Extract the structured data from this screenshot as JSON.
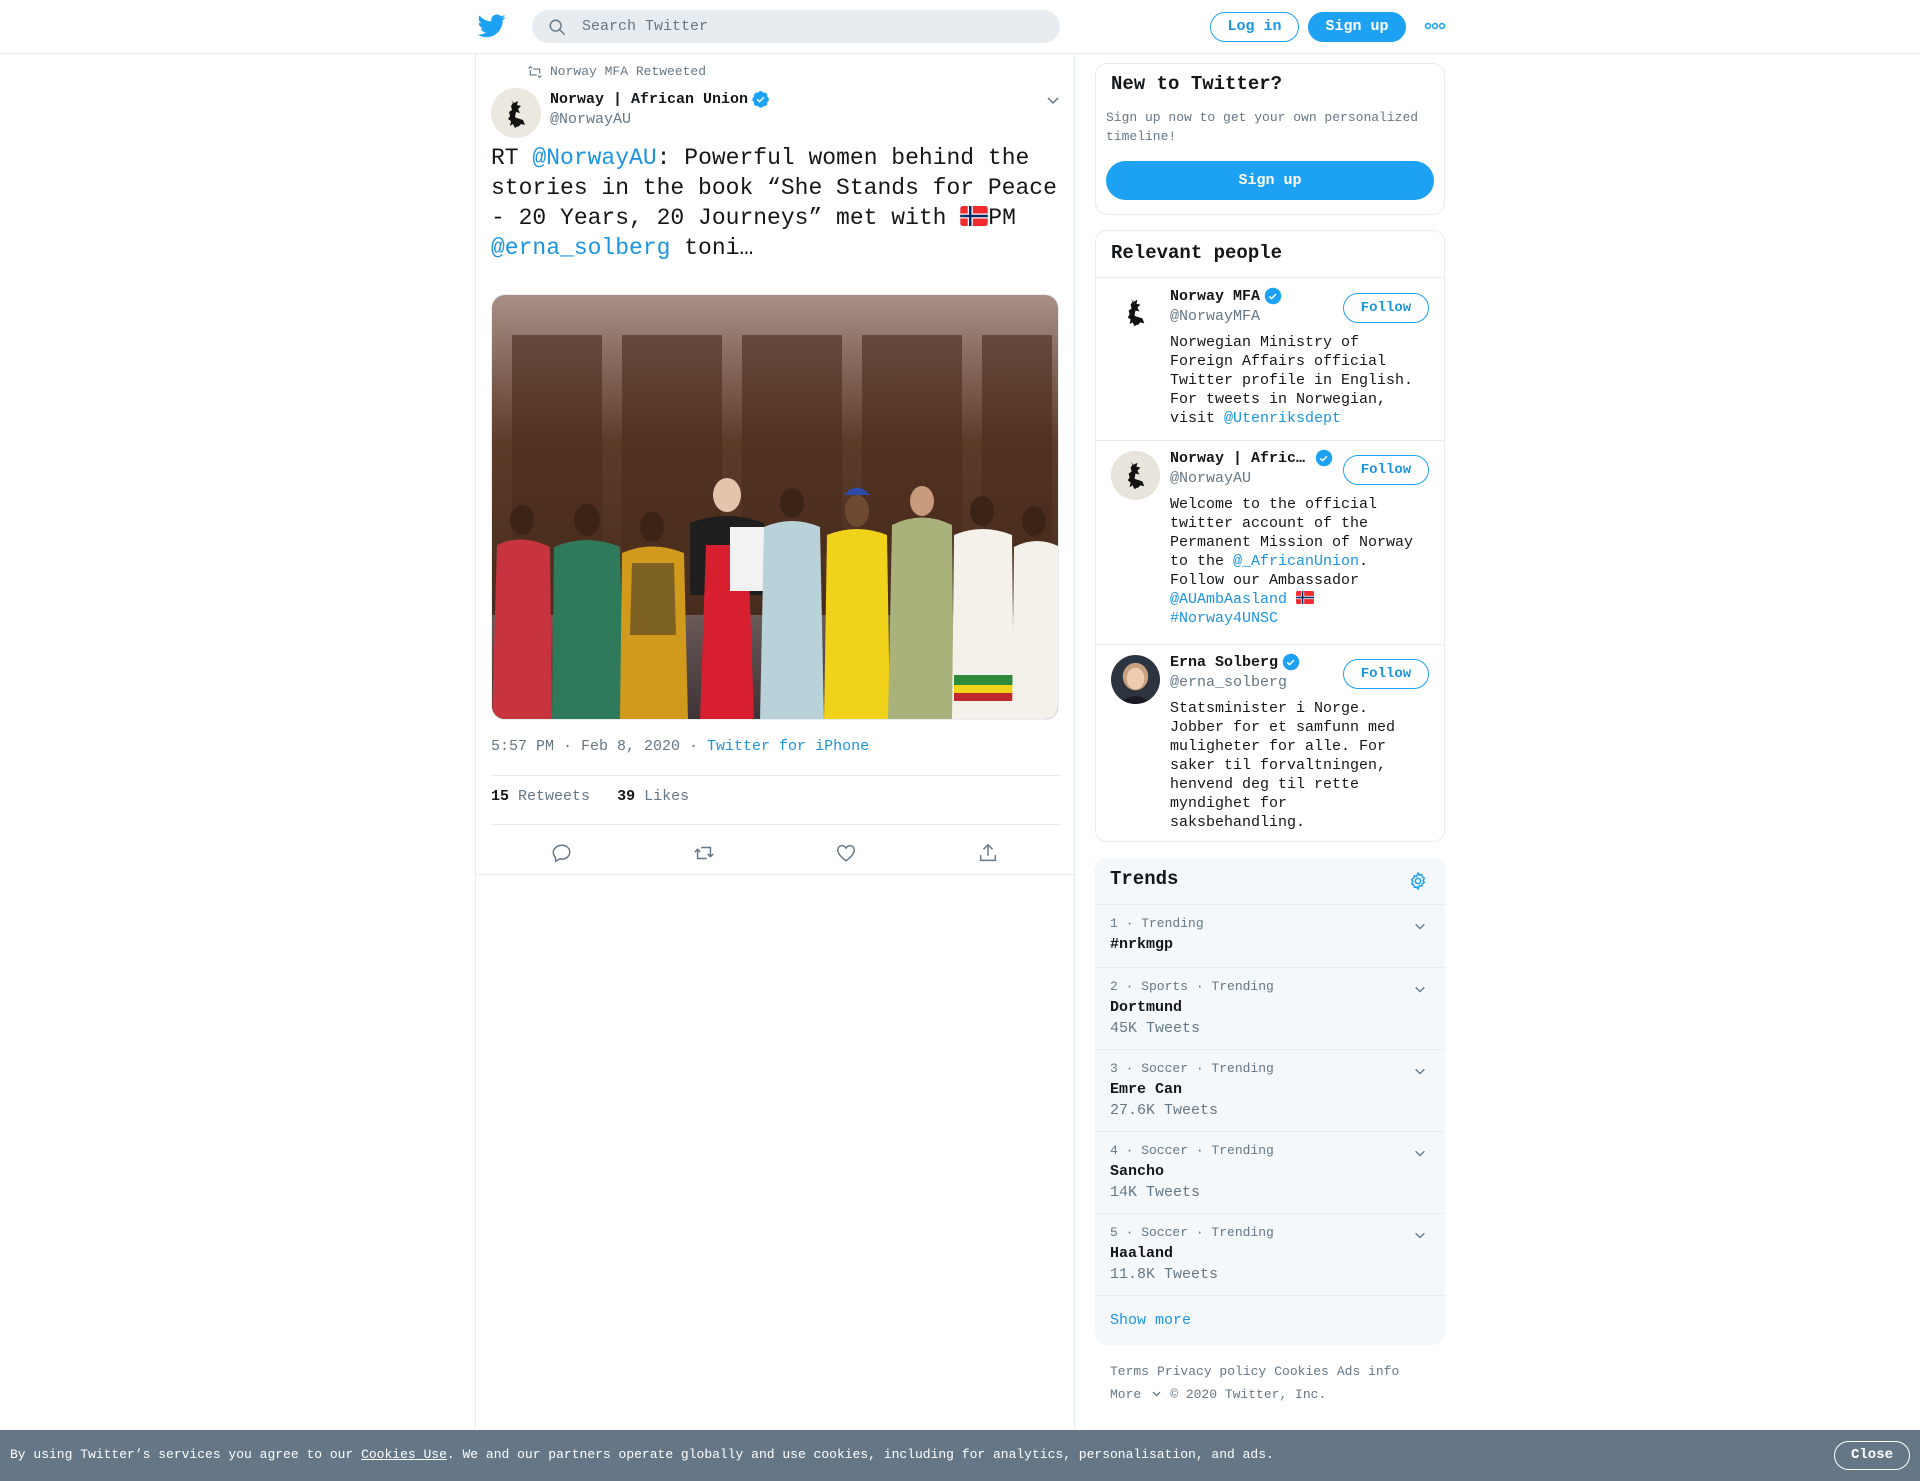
{
  "header": {
    "search_placeholder": "Search Twitter",
    "login_label": "Log in",
    "signup_label": "Sign up",
    "more_icon": "more-dots-icon",
    "brand_color": "#1da1f2"
  },
  "tweet": {
    "retweet_context": "Norway MFA Retweeted",
    "author_name": "Norway | African Union",
    "author_handle": "@NorwayAU",
    "text": {
      "prefix": "RT ",
      "mention1": "@NorwayAU",
      "body": ": Powerful women behind the stories in the book “She Stands for Peace - 20 Years, 20 Journeys” met with ",
      "after_flag": "PM ",
      "mention2": "@erna_solberg",
      "suffix": " toni…"
    },
    "time": "5:57 PM · Feb 8, 2020",
    "separator": " · ",
    "source": "Twitter for iPhone",
    "retweets_count": "15",
    "retweets_label": "Retweets",
    "likes_count": "39",
    "likes_label": "Likes"
  },
  "sidebar": {
    "new_to_twitter": {
      "title": "New to Twitter?",
      "subtitle": "Sign up now to get your own personalized timeline!",
      "button": "Sign up"
    },
    "relevant_people": {
      "title": "Relevant people",
      "follow_label": "Follow",
      "people": [
        {
          "name": "Norway MFA",
          "handle": "@NorwayMFA",
          "bio": "Norwegian Ministry of Foreign Affairs official Twitter profile in English. For tweets in Norwegian, visit ",
          "bio_link": "@Utenriksdept"
        },
        {
          "name": "Norway | Afric…",
          "handle": "@NorwayAU",
          "bio_a": "Welcome to the official twitter account of the Permanent Mission of Norway to the ",
          "bio_link1": "@_AfricanUnion",
          "bio_b": ". Follow our Ambassador ",
          "bio_link2": "@AUAmbAasland",
          "bio_link3": "#Norway4UNSC"
        },
        {
          "name": "Erna Solberg",
          "handle": "@erna_solberg",
          "bio": "Statsminister i Norge. Jobber for et samfunn med muligheter for alle. For saker til forvaltningen, henvend deg til rette myndighet for saksbehandling."
        }
      ]
    },
    "trends": {
      "title": "Trends",
      "items": [
        {
          "meta": "1 · Trending",
          "name": "#nrkmgp",
          "count": ""
        },
        {
          "meta": "2 · Sports · Trending",
          "name": "Dortmund",
          "count": "45K Tweets"
        },
        {
          "meta": "3 · Soccer · Trending",
          "name": "Emre Can",
          "count": "27.6K Tweets"
        },
        {
          "meta": "4 · Soccer · Trending",
          "name": "Sancho",
          "count": "14K Tweets"
        },
        {
          "meta": "5 · Soccer · Trending",
          "name": "Haaland",
          "count": "11.8K Tweets"
        }
      ],
      "show_more": "Show more"
    },
    "footer": {
      "terms": "Terms",
      "privacy": "Privacy policy",
      "cookies": "Cookies",
      "ads": "Ads info",
      "more": "More",
      "copyright": "© 2020 Twitter, Inc."
    }
  },
  "cookie_banner": {
    "text_before": "By using Twitter’s services you agree to our ",
    "link": "Cookies Use",
    "text_after": ". We and our partners operate globally and use cookies, including for analytics, personalisation, and ads.",
    "close_label": "Close"
  }
}
